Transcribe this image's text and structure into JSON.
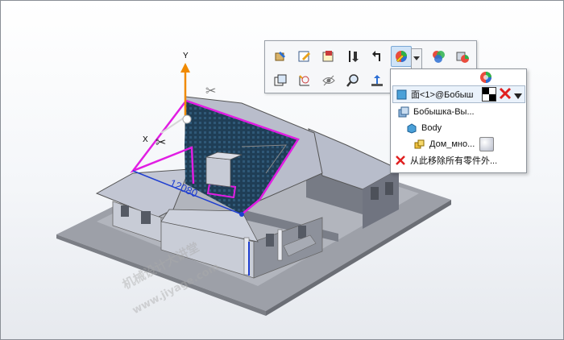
{
  "viewport": {
    "bg_top": "#ffffff",
    "bg_bottom": "#e6e9ee"
  },
  "scene": {
    "dimension_value": "12080",
    "axis_y_label": "Y",
    "axis_x_label": "X",
    "roof_texture_color": "#1f3e56",
    "selection_color": "#e11de3",
    "house_color": "#b7bccb",
    "base_color": "#9da0a8"
  },
  "toolbar": {
    "icons": [
      "edit-feature-icon",
      "edit-sketch-icon",
      "sketch-plane-icon",
      "rollback-icon",
      "parent-child-icon",
      "appearance-icon",
      "appearances-override-icon",
      "part-appearance-icon",
      "normal-to-icon",
      "sketch-icon",
      "hide-icon",
      "zoom-selection-icon",
      "measure-icon"
    ]
  },
  "panel": {
    "header_icon": "color-wheel-icon",
    "selection_text": "面<1>@Бобыш",
    "rows": [
      {
        "icon": "feature-icon",
        "label": "Бобышка-Вы..."
      },
      {
        "icon": "body-icon",
        "label": "Body"
      },
      {
        "icon": "part-icon",
        "label": "Дом_мно..."
      },
      {
        "icon": "remove-icon",
        "label": "从此移除所有零件外..."
      }
    ]
  },
  "watermark": {
    "line1": "机械设计大讲堂",
    "line2": "www.jiyage.com"
  }
}
